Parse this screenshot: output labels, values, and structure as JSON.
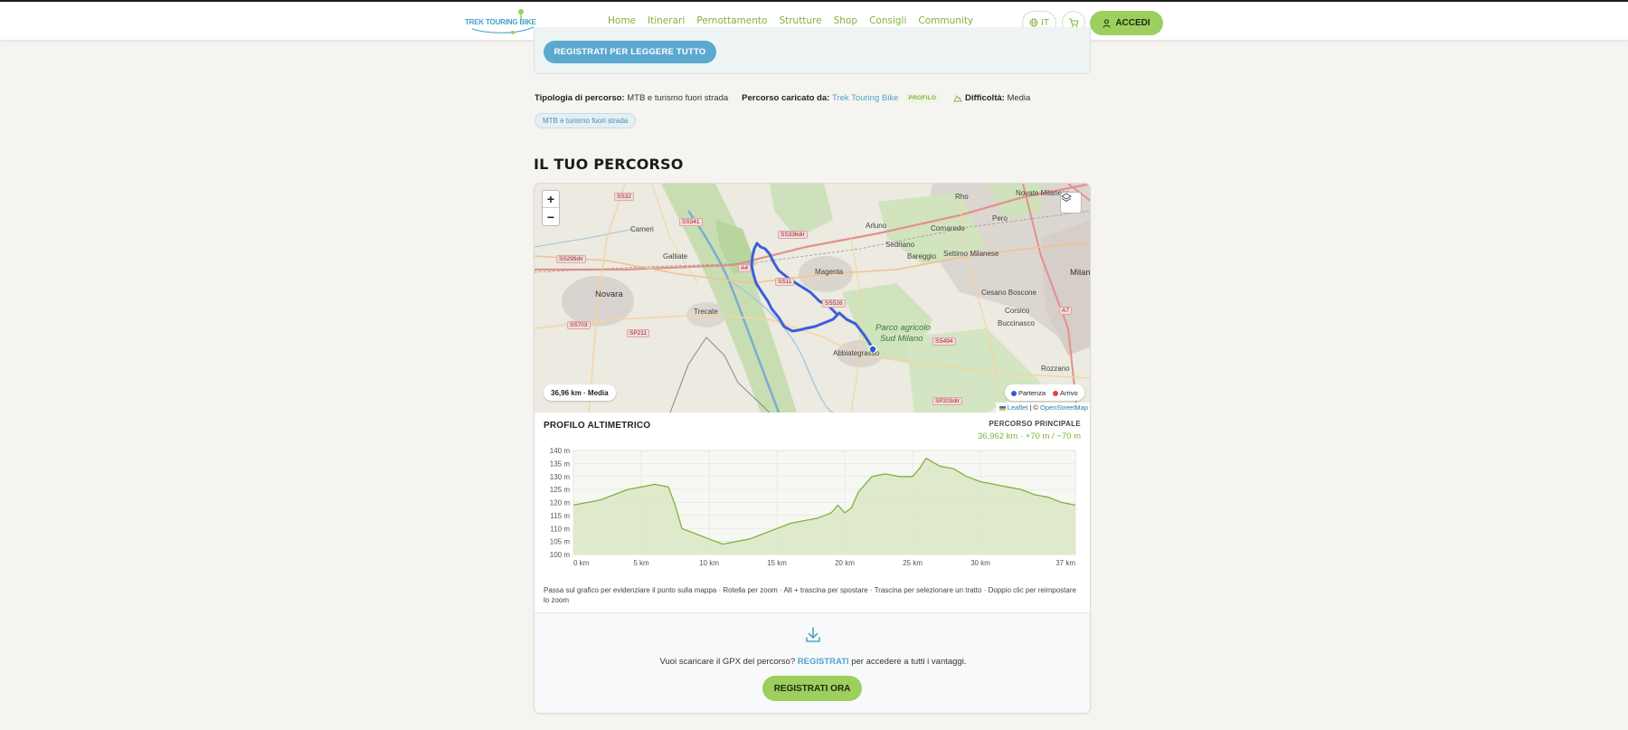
{
  "header": {
    "logo_text": "TREK TOURING BIKE",
    "nav": [
      "Home",
      "Itinerari",
      "Pernottamento",
      "Strutture",
      "Shop",
      "Consigli",
      "Community"
    ],
    "lang_label": "IT",
    "login_label": "ACCEDI"
  },
  "gate": {
    "button_label": "REGISTRATI PER LEGGERE TUTTO"
  },
  "meta": {
    "type_label": "Tipologia di percorso:",
    "type_value": "MTB e turismo fuori strada",
    "uploader_label": "Percorso caricato da:",
    "uploader_name": "Trek Touring Bike",
    "profile_badge": "PROFILO",
    "difficulty_label": "Difficoltà:",
    "difficulty_value": "Media",
    "tag": "MTB e turismo fuori strada"
  },
  "section_title": "IL TUO PERCORSO",
  "map": {
    "zoom_in": "+",
    "zoom_out": "−",
    "distance_pill": "36,96 km · Media",
    "legend_start": "Partenza",
    "legend_end": "Arrivo",
    "attribution_leaflet": "Leaflet",
    "attribution_sep": " | © ",
    "attribution_osm": "OpenStreetMap",
    "places": {
      "cameri": "Cameri",
      "galliate": "Galliate",
      "novara": "Novara",
      "trecate": "Trecate",
      "magenta": "Magenta",
      "arluno": "Arluno",
      "sedriano": "Sedriano",
      "cornaredo": "Cornaredo",
      "bareggio": "Bareggio",
      "settimo": "Settimo Milanese",
      "rho": "Rho",
      "pero": "Pero",
      "novate": "Novate Milanese",
      "milano": "Milan",
      "cesano": "Cesano Boscone",
      "corsico": "Corsico",
      "buccinasco": "Buccinasco",
      "rozzano": "Rozzano",
      "abbiategrasso": "Abbiategrasso",
      "parco1": "Parco agricolo",
      "parco2": "Sud Milano"
    },
    "roads": {
      "ss32": "SS32",
      "ss341": "SS341",
      "ss336dir": "SS336dir",
      "ss299dir": "SS299dir",
      "a4": "A4",
      "ss11": "SS11",
      "ss526": "SS526",
      "ss703": "SS703",
      "sp211": "SP211",
      "ss494": "SS494",
      "a7": "A7",
      "sp203dir": "SP203dir"
    },
    "colors": {
      "route": "#3a5fd8",
      "start": "#2f5bd6",
      "end": "#e04545"
    }
  },
  "elevation": {
    "title": "PROFILO ALTIMETRICO",
    "route_label": "PERCORSO PRINCIPALE",
    "stats": "36,962 km · +70 m / −70 m",
    "hint": "Passa sul grafico per evidenziare il punto sulla mappa · Rotella per zoom · Alt + trascina per spostare · Trascina per selezionare un tratto · Doppio clic per reimpostare lo zoom"
  },
  "chart_data": {
    "type": "area",
    "title": "",
    "xlabel": "",
    "ylabel": "",
    "x_unit": "km",
    "y_unit": "m",
    "xlim": [
      0,
      37
    ],
    "ylim": [
      100,
      140
    ],
    "x_ticks": [
      "0 km",
      "5 km",
      "10 km",
      "15 km",
      "20 km",
      "25 km",
      "30 km",
      "37 km"
    ],
    "y_ticks": [
      "140 m",
      "135 m",
      "130 m",
      "125 m",
      "120 m",
      "115 m",
      "110 m",
      "105 m",
      "100 m"
    ],
    "x": [
      0,
      1,
      2,
      3,
      4,
      5,
      6,
      7,
      7.5,
      8,
      8.5,
      9,
      10,
      11,
      11.5,
      12,
      13,
      14,
      15,
      16,
      17,
      18,
      19,
      19.5,
      20,
      20.5,
      21,
      22,
      23,
      24,
      25,
      25.5,
      26,
      27,
      28,
      29,
      30,
      31,
      32,
      33,
      34,
      35,
      36,
      37
    ],
    "y": [
      119,
      120,
      121,
      123,
      125,
      126,
      127,
      126,
      119,
      110,
      109,
      108,
      106,
      104,
      104.5,
      105,
      106,
      108,
      110,
      112,
      113,
      114,
      116,
      119,
      116,
      118,
      124,
      130,
      131,
      130,
      130,
      133,
      137,
      134,
      133,
      130,
      128,
      127,
      126,
      125,
      123,
      122,
      120,
      119
    ],
    "color": "#7fb33b",
    "fill": "#dbe8c8"
  },
  "gpx": {
    "text_before": "Vuoi scaricare il GPX del percorso? ",
    "link": "REGISTRATI",
    "text_after": " per accedere a tutti i vantaggi.",
    "button_label": "REGISTRATI ORA"
  }
}
